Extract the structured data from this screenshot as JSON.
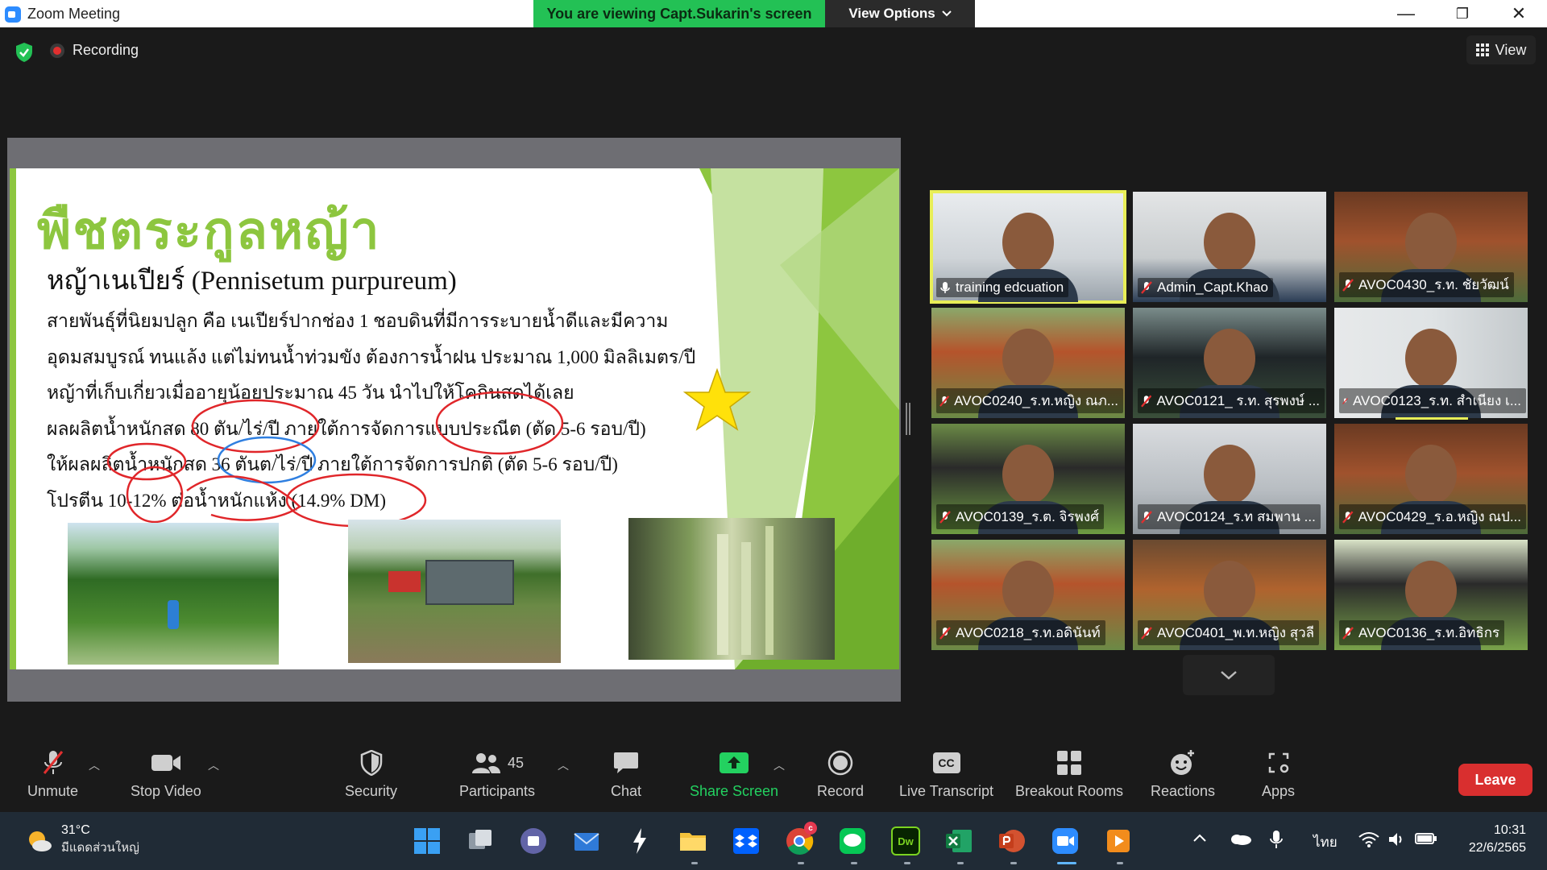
{
  "window": {
    "title": "Zoom Meeting",
    "banner": "You are viewing Capt.Sukarin's screen",
    "view_options": "View Options",
    "minimize": "—",
    "restore": "❐",
    "close": "✕"
  },
  "status": {
    "recording": "Recording",
    "view": "View"
  },
  "slide": {
    "title": "พืชตระกูลหญ้า",
    "subtitle": "หญ้าเนเปียร์ (Pennisetum purpureum)",
    "lines": [
      "สายพันธุ์ที่นิยมปลูก คือ เนเปียร์ปากช่อง 1 ชอบดินที่มีการระบายน้ำดีและมีความ",
      "อุดมสมบูรณ์ ทนแล้ง แต่ไม่ทนน้ำท่วมขัง ต้องการน้ำฝน ประมาณ 1,000 มิลลิเมตร/ปี",
      "หญ้าที่เก็บเกี่ยวเมื่ออายุน้อยประมาณ 45 วัน นำไปให้โคกินสดได้เลย",
      "ผลผลิตน้ำหนักสด 80 ตัน/ไร่/ปี ภายใต้การจัดการแบบประณีต (ตัด 5-6 รอบ/ปี)",
      "ให้ผลผลิตน้ำหนักสด 36 ตันต/ไร่/ปี ภายใต้การจัดการปกติ (ตัด 5-6 รอบ/ปี)",
      "โปรตีน 10-12% ต่อน้ำหนักแห้ง (14.9% DM)"
    ]
  },
  "participants": [
    {
      "name": "training edcuation",
      "muted": false,
      "active": true
    },
    {
      "name": "Admin_Capt.Khao",
      "muted": true,
      "active": false
    },
    {
      "name": "AVOC0430_ร.ท. ชัยวัฒน์",
      "muted": true,
      "active": false
    },
    {
      "name": "AVOC0240_ร.ท.หญิง ณภ...",
      "muted": true,
      "active": false
    },
    {
      "name": "AVOC0121_ ร.ท. สุรพงษ์ ...",
      "muted": true,
      "active": false
    },
    {
      "name": "AVOC0123_ร.ท. สำเนียง เ...",
      "muted": true,
      "active": false
    },
    {
      "name": "AVOC0139_ร.ต. จิรพงศ์",
      "muted": true,
      "active": false
    },
    {
      "name": "AVOC0124_ร.ท สมพาน ...",
      "muted": true,
      "active": false
    },
    {
      "name": "AVOC0429_ร.อ.หญิง ณป...",
      "muted": true,
      "active": false
    },
    {
      "name": "AVOC0218_ร.ท.อดินันท์",
      "muted": true,
      "active": false
    },
    {
      "name": "AVOC0401_พ.ท.หญิง สุวลี",
      "muted": true,
      "active": false
    },
    {
      "name": "AVOC0136_ร.ท.อิทธิกร",
      "muted": true,
      "active": false
    }
  ],
  "toolbar": {
    "unmute": "Unmute",
    "stop_video": "Stop Video",
    "security": "Security",
    "participants": "Participants",
    "participants_count": "45",
    "chat": "Chat",
    "share_screen": "Share Screen",
    "record": "Record",
    "live_transcript": "Live Transcript",
    "cc": "CC",
    "breakout_rooms": "Breakout Rooms",
    "reactions": "Reactions",
    "apps": "Apps",
    "leave": "Leave"
  },
  "taskbar": {
    "temperature": "31°C",
    "weather": "มีแดดส่วนใหญ่",
    "language": "ไทย",
    "time": "10:31",
    "date": "22/6/2565",
    "dw": "Dw",
    "chrome_badge": "c"
  },
  "colors": {
    "accent_green": "#23c155",
    "leave_red": "#d92f2f",
    "active_speaker": "#e8ee57",
    "slide_title": "#8dc63f"
  }
}
